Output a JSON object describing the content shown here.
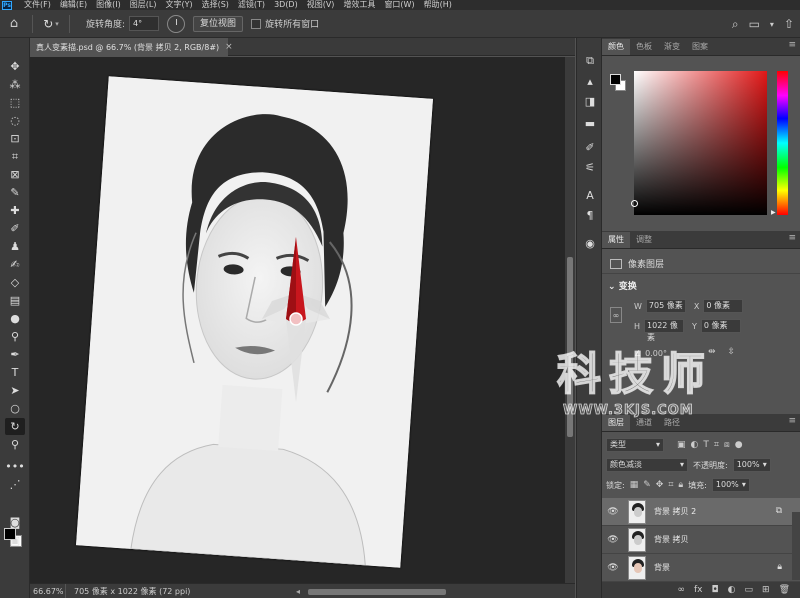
{
  "app": {
    "logo": "Ps"
  },
  "menu": [
    "文件(F)",
    "编辑(E)",
    "图像(I)",
    "图层(L)",
    "文字(Y)",
    "选择(S)",
    "滤镜(T)",
    "3D(D)",
    "视图(V)",
    "增效工具",
    "窗口(W)",
    "帮助(H)"
  ],
  "options": {
    "rotation_label": "旋转角度:",
    "rotation_value": "4°",
    "reset_button": "复位视图",
    "rotate_all_label": "旋转所有窗口"
  },
  "document_tab": {
    "title": "真人变素描.psd @ 66.7% (背景 拷贝 2, RGB/8#)",
    "close": "×"
  },
  "status": {
    "zoom": "66.67%",
    "info": "705 像素 x 1022 像素 (72 ppi)"
  },
  "color_panel": {
    "tabs": [
      "颜色",
      "色板",
      "渐变",
      "图案"
    ]
  },
  "properties_panel": {
    "tabs": [
      "属性",
      "调整"
    ],
    "layer_type": "像素图层",
    "section": "变换",
    "w_label": "W",
    "w_value": "705 像素",
    "h_label": "H",
    "h_value": "1022 像素",
    "x_label": "X",
    "x_value": "0 像素",
    "y_label": "Y",
    "y_value": "0 像素",
    "angle_value": "0.00°"
  },
  "layers_panel": {
    "tabs": [
      "图层",
      "通道",
      "路径"
    ],
    "filter_kind": "类型",
    "blend_mode": "颜色减淡",
    "opacity_label": "不透明度:",
    "opacity_value": "100%",
    "lock_label": "锁定:",
    "fill_label": "填充:",
    "fill_value": "100%",
    "layers": [
      {
        "name": "背景 拷贝 2",
        "selected": true
      },
      {
        "name": "背景 拷贝",
        "selected": false
      },
      {
        "name": "背景",
        "selected": false
      }
    ]
  },
  "watermark": {
    "main": "科技师",
    "url": "WWW.3KJS.COM"
  },
  "colors": {
    "accent_red": "#c8161d",
    "foreground": "#000000",
    "background": "#ffffff"
  }
}
